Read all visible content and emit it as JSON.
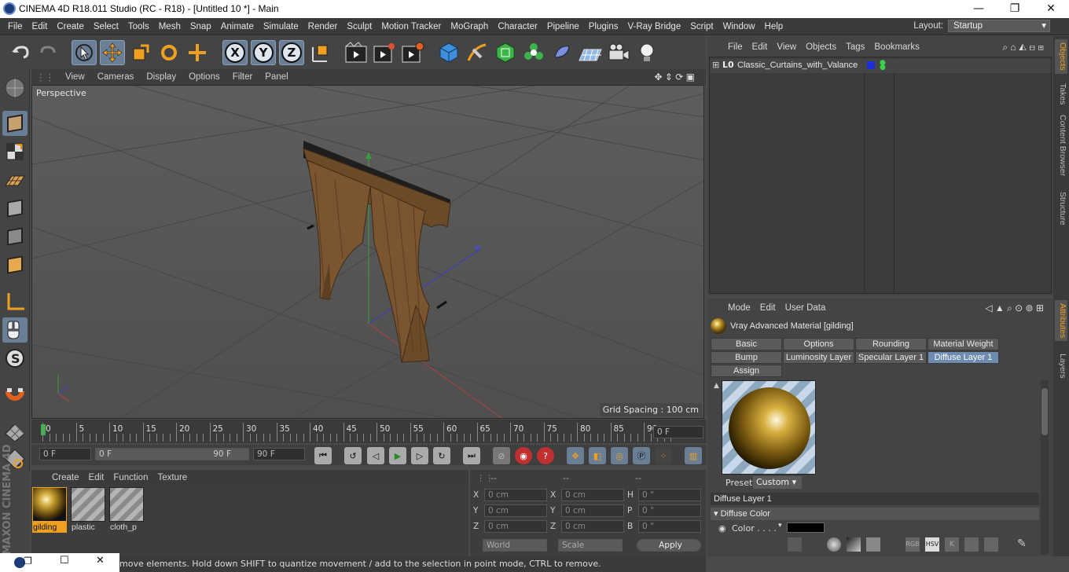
{
  "window": {
    "title": "CINEMA 4D R18.011 Studio (RC - R18) - [Untitled 10 *] - Main",
    "minimize": "—",
    "maximize": "❐",
    "close": "✕"
  },
  "menu": [
    "File",
    "Edit",
    "Create",
    "Select",
    "Tools",
    "Mesh",
    "Snap",
    "Animate",
    "Simulate",
    "Render",
    "Sculpt",
    "Motion Tracker",
    "MoGraph",
    "Character",
    "Pipeline",
    "Plugins",
    "V-Ray Bridge",
    "Script",
    "Window",
    "Help"
  ],
  "layout": {
    "label": "Layout:",
    "value": "Startup"
  },
  "viewport": {
    "menu": [
      "View",
      "Cameras",
      "Display",
      "Options",
      "Filter",
      "Panel"
    ],
    "camera": "Perspective",
    "grid_spacing": "Grid Spacing : 100 cm"
  },
  "timeline": {
    "ticks": [
      "0",
      "5",
      "10",
      "15",
      "20",
      "25",
      "30",
      "35",
      "40",
      "45",
      "50",
      "55",
      "60",
      "65",
      "70",
      "75",
      "80",
      "85",
      "90"
    ],
    "end_field": "0 F",
    "start": "0 F",
    "range_start": "0 F",
    "range_end": "90 F",
    "end": "90 F"
  },
  "materials": {
    "menu": [
      "Create",
      "Edit",
      "Function",
      "Texture"
    ],
    "items": [
      {
        "name": "gilding"
      },
      {
        "name": "plastic"
      },
      {
        "name": "cloth_p"
      }
    ]
  },
  "coords": {
    "headers": [
      "--",
      "--",
      "--"
    ],
    "rows": [
      {
        "a": "X",
        "av": "0 cm",
        "b": "X",
        "bv": "0 cm",
        "c": "H",
        "cv": "0 °"
      },
      {
        "a": "Y",
        "av": "0 cm",
        "b": "Y",
        "bv": "0 cm",
        "c": "P",
        "cv": "0 °"
      },
      {
        "a": "Z",
        "av": "0 cm",
        "b": "Z",
        "bv": "0 cm",
        "c": "B",
        "cv": "0 °"
      }
    ],
    "world": "World",
    "scale": "Scale",
    "apply": "Apply"
  },
  "status": "move elements. Hold down SHIFT to quantize movement / add to the selection in point mode, CTRL to remove.",
  "objects": {
    "menu": [
      "File",
      "Edit",
      "View",
      "Objects",
      "Tags",
      "Bookmarks"
    ],
    "items": [
      {
        "name": "Classic_Curtains_with_Valance"
      }
    ],
    "layer_icon": "L0"
  },
  "sidetabs": [
    "Objects",
    "Takes",
    "Content Browser",
    "Structure",
    "Attributes",
    "Layers"
  ],
  "attributes": {
    "menu": [
      "Mode",
      "Edit",
      "User Data"
    ],
    "title": "Vray Advanced Material [gilding]",
    "tabs_row1": [
      "Basic",
      "Options",
      "Rounding",
      "Material Weight"
    ],
    "tabs_row2": [
      "Bump",
      "Luminosity Layer",
      "Specular Layer 1",
      "Diffuse Layer 1"
    ],
    "tabs_row3": [
      "Assign"
    ],
    "preset_label": "Preset",
    "preset_value": "Custom",
    "section": "Diffuse Layer 1",
    "subsection": "Diffuse Color",
    "color_label": "Color . . . ."
  },
  "brand": "MAXON CINEMA 4D",
  "taskbar": {
    "restore": "❐",
    "minimize": "☐",
    "close": "✕"
  }
}
